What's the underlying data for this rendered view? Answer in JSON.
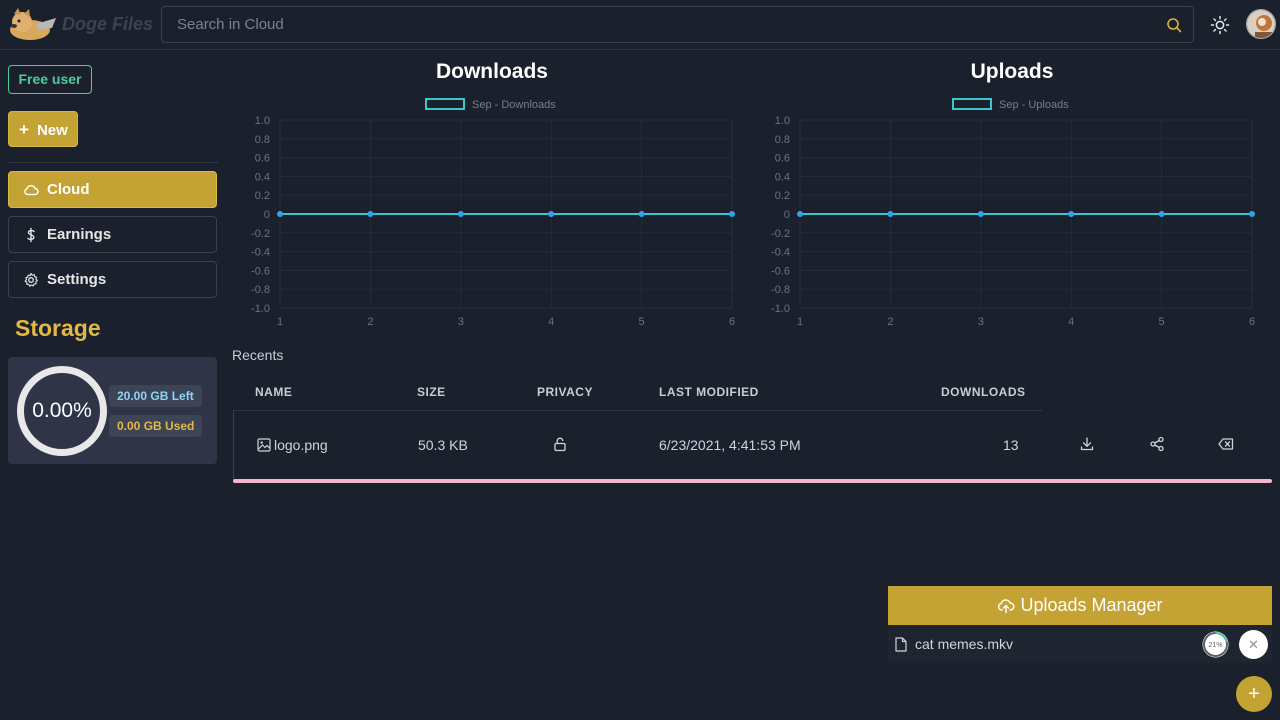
{
  "header": {
    "brand": "Doge Files",
    "search_placeholder": "Search in Cloud"
  },
  "sidebar": {
    "plan_badge": "Free user",
    "new_button": "New",
    "nav": [
      {
        "label": "Cloud",
        "icon": "cloud-icon",
        "active": true
      },
      {
        "label": "Earnings",
        "icon": "dollar-icon",
        "active": false
      },
      {
        "label": "Settings",
        "icon": "gear-icon",
        "active": false
      }
    ],
    "storage": {
      "title": "Storage",
      "percent_label": "0.00%",
      "used_fraction": 0.0,
      "left_label": "20.00 GB Left",
      "used_label": "0.00 GB Used"
    }
  },
  "chart_data": [
    {
      "type": "line",
      "title": "Downloads",
      "series": [
        {
          "name": "Sep - Downloads",
          "x": [
            1,
            2,
            3,
            4,
            5,
            6
          ],
          "values": [
            0,
            0,
            0,
            0,
            0,
            0
          ]
        }
      ],
      "x_ticks": [
        "1",
        "2",
        "3",
        "4",
        "5",
        "6"
      ],
      "y_ticks": [
        "1.0",
        "0.8",
        "0.6",
        "0.4",
        "0.2",
        "0",
        "-0.2",
        "-0.4",
        "-0.6",
        "-0.8",
        "-1.0"
      ],
      "ylim": [
        -1,
        1
      ],
      "grid": true,
      "legend_position": "top"
    },
    {
      "type": "line",
      "title": "Uploads",
      "series": [
        {
          "name": "Sep - Uploads",
          "x": [
            1,
            2,
            3,
            4,
            5,
            6
          ],
          "values": [
            0,
            0,
            0,
            0,
            0,
            0
          ]
        }
      ],
      "x_ticks": [
        "1",
        "2",
        "3",
        "4",
        "5",
        "6"
      ],
      "y_ticks": [
        "1.0",
        "0.8",
        "0.6",
        "0.4",
        "0.2",
        "0",
        "-0.2",
        "-0.4",
        "-0.6",
        "-0.8",
        "-1.0"
      ],
      "ylim": [
        -1,
        1
      ],
      "grid": true,
      "legend_position": "top"
    }
  ],
  "recents": {
    "title": "Recents",
    "columns": [
      "NAME",
      "SIZE",
      "PRIVACY",
      "LAST MODIFIED",
      "DOWNLOADS"
    ],
    "rows": [
      {
        "name": "logo.png",
        "size": "50.3 KB",
        "privacy": "unlocked",
        "modified": "6/23/2021, 4:41:53 PM",
        "downloads": "13"
      }
    ]
  },
  "uploads_manager": {
    "title": "Uploads Manager",
    "file": "cat memes.mkv",
    "progress_label": "21%",
    "progress": 0.21
  },
  "colors": {
    "accent": "#c4a233",
    "background": "#1b202d",
    "line": "#3ec3d0",
    "point": "#36a2eb",
    "free_badge": "#4ecb9b"
  }
}
